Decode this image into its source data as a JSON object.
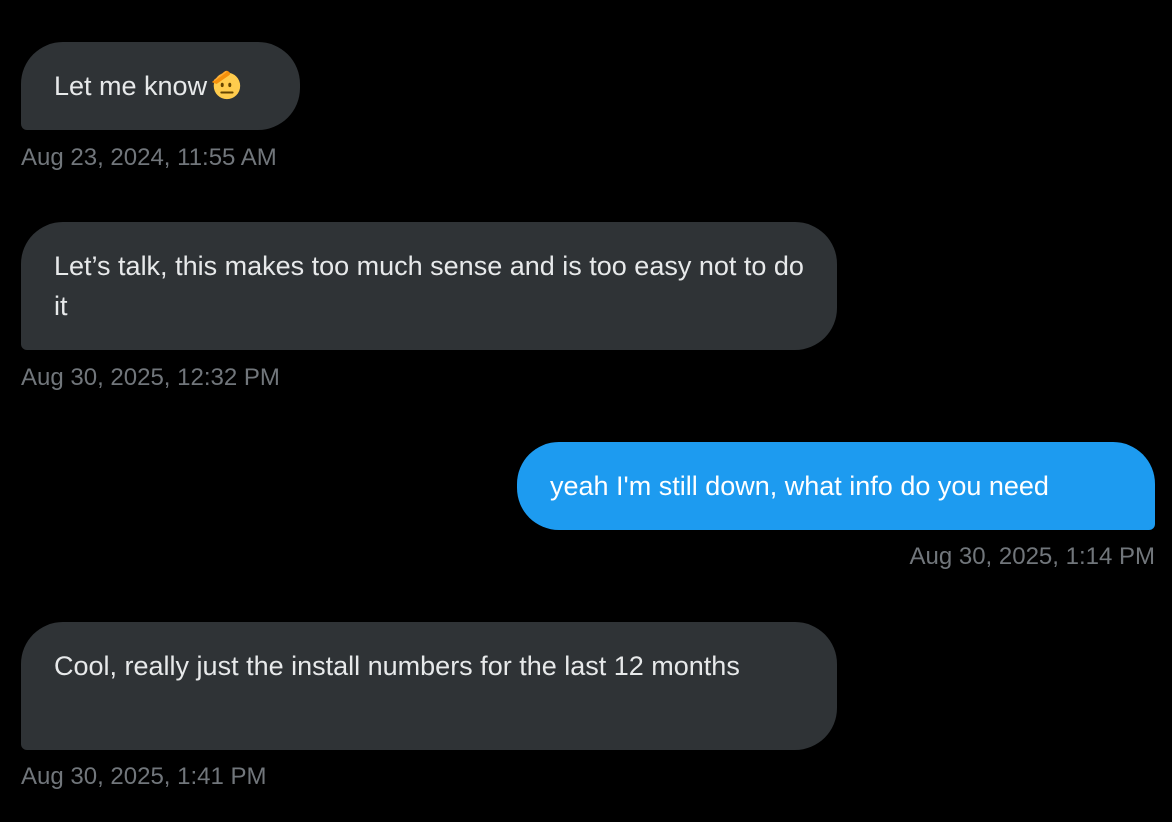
{
  "messages": [
    {
      "direction": "incoming",
      "text": "Let me know",
      "emoji": "saluting-face-icon",
      "timestamp": "Aug 23, 2024, 11:55 AM"
    },
    {
      "direction": "incoming",
      "text": "Let’s talk, this makes too much sense and is too easy not to do it",
      "timestamp": "Aug 30, 2025, 12:32 PM"
    },
    {
      "direction": "outgoing",
      "text": "yeah I'm still down, what info do you need",
      "timestamp": "Aug 30, 2025, 1:14 PM"
    },
    {
      "direction": "incoming",
      "text": "Cool, really just the install numbers for the last 12 months",
      "timestamp": "Aug 30, 2025, 1:41 PM"
    }
  ],
  "colors": {
    "background": "#000000",
    "incoming_bubble": "#2f3336",
    "outgoing_bubble": "#1d9bf0",
    "text": "#e7e9ea",
    "timestamp": "#71767b"
  }
}
